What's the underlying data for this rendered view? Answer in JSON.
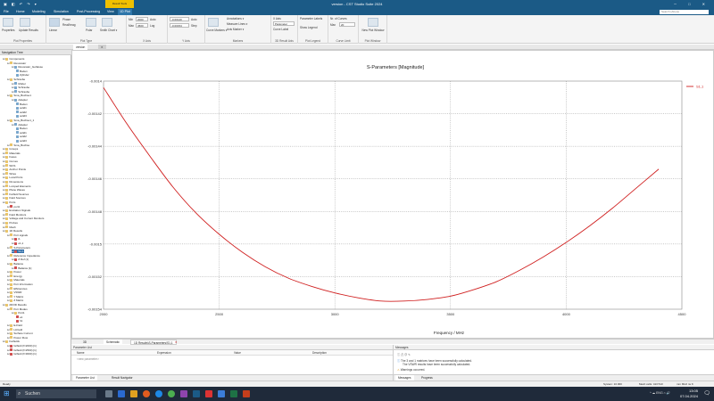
{
  "window": {
    "title": "version - CST Studio Suite 2024",
    "quick_access": "▣ ◧ ↶ ↷ ▾",
    "controls": "─ □ ✕",
    "context_tab": "Result Tools",
    "context_sub": "1D Plot"
  },
  "menu": {
    "items": [
      "File",
      "Home",
      "Modeling",
      "Simulation",
      "Post-Processing",
      "View"
    ],
    "active": "1D Plot",
    "search_placeholder": "Search (Alt+Q)"
  },
  "ribbon": {
    "groups": [
      {
        "label": "Plot Properties"
      },
      {
        "label": "Plot Type"
      },
      {
        "label": "X Axis"
      },
      {
        "label": "Y Axis"
      },
      {
        "label": "Markers"
      },
      {
        "label": "3D Result Axis"
      },
      {
        "label": "Plot Legend"
      },
      {
        "label": "Curve Limit"
      },
      {
        "label": "Plot Window"
      }
    ],
    "properties_btn": "Properties",
    "update_results_btn": "Update Results",
    "linear_btn": "Linear",
    "phase_label": "Phase",
    "real_imag_label": "Real/Imag",
    "polar_label": "Polar",
    "smith_label": "Smith Chart ▾",
    "x_min_label": "Min",
    "x_min_value": "2000",
    "x_max_label": "Max",
    "x_max_value": "4500",
    "x_auto": "Auto",
    "x_log": "Log",
    "y_min_label": "Min",
    "y_min_value": "-0.00154",
    "y_max_label": "Max",
    "y_max_value": "-0.00140",
    "y_auto": "Auto",
    "y_step": "Step",
    "curve_markers": "Curve Markers ▾",
    "annotations": "Annotations ▾",
    "measure_lines": "Measure Lines ▾",
    "axis_marker": "Axis Marker ▾",
    "axis_label": "X Axis",
    "axis_value": "Parameter",
    "curve_label_btn": "Curve Label",
    "param_labels": "Parameter Labels",
    "show_legend": "Show Legend",
    "num_curves_label": "Nr. of Curves",
    "num_curves_max_label": "Max",
    "num_curves_value": "20",
    "new_plot_window": "New Plot Window"
  },
  "doc_tabs": [
    {
      "label": "Navigation Tree"
    },
    {
      "label": "version"
    },
    {
      "label": "3D"
    }
  ],
  "nav": {
    "header": "Navigation Tree",
    "items": [
      {
        "label": "Components",
        "depth": 0,
        "icon": "f"
      },
      {
        "label": "Resonator",
        "depth": 1,
        "icon": "f"
      },
      {
        "label": "Resonator_Gehäuse",
        "depth": 2,
        "icon": "b"
      },
      {
        "label": "Boden",
        "depth": 3,
        "icon": "b"
      },
      {
        "label": "Zylinder",
        "depth": 3,
        "icon": "b"
      },
      {
        "label": "Schraube",
        "depth": 1,
        "icon": "f"
      },
      {
        "label": "Mutter",
        "depth": 2,
        "icon": "b"
      },
      {
        "label": "Schraube",
        "depth": 2,
        "icon": "b"
      },
      {
        "label": "Schraube",
        "depth": 2,
        "icon": "b"
      },
      {
        "label": "Sma_Buchse1",
        "depth": 1,
        "icon": "f"
      },
      {
        "label": "Adapter",
        "depth": 2,
        "icon": "b"
      },
      {
        "label": "Boden",
        "depth": 3,
        "icon": "b"
      },
      {
        "label": "solid1",
        "depth": 3,
        "icon": "b"
      },
      {
        "label": "solid2",
        "depth": 3,
        "icon": "b"
      },
      {
        "label": "solid3",
        "depth": 3,
        "icon": "b"
      },
      {
        "label": "Sma_Buchse1_1",
        "depth": 1,
        "icon": "f"
      },
      {
        "label": "Adapter",
        "depth": 2,
        "icon": "b"
      },
      {
        "label": "Boden",
        "depth": 3,
        "icon": "b"
      },
      {
        "label": "solid1",
        "depth": 3,
        "icon": "b"
      },
      {
        "label": "solid2",
        "depth": 3,
        "icon": "b"
      },
      {
        "label": "solid3",
        "depth": 3,
        "icon": "b"
      },
      {
        "label": "Sma_Buchse",
        "depth": 1,
        "icon": "f"
      },
      {
        "label": "Groups",
        "depth": 0,
        "icon": "f"
      },
      {
        "label": "Materials",
        "depth": 0,
        "icon": "f"
      },
      {
        "label": "Faces",
        "depth": 0,
        "icon": "f"
      },
      {
        "label": "Curves",
        "depth": 0,
        "icon": "f"
      },
      {
        "label": "WCS",
        "depth": 0,
        "icon": "f"
      },
      {
        "label": "Anchor Points",
        "depth": 0,
        "icon": "f"
      },
      {
        "label": "Wires",
        "depth": 0,
        "icon": "f"
      },
      {
        "label": "Local Ports",
        "depth": 0,
        "icon": "f"
      },
      {
        "label": "Dimensions",
        "depth": 0,
        "icon": "f"
      },
      {
        "label": "Lumped Elements",
        "depth": 0,
        "icon": "f"
      },
      {
        "label": "Plane Waves",
        "depth": 0,
        "icon": "f"
      },
      {
        "label": "Farfield Sources",
        "depth": 0,
        "icon": "f"
      },
      {
        "label": "Field Sources",
        "depth": 0,
        "icon": "f"
      },
      {
        "label": "Ports",
        "depth": 0,
        "icon": "f"
      },
      {
        "label": "port1",
        "depth": 1,
        "icon": "r"
      },
      {
        "label": "Excitation Signals",
        "depth": 0,
        "icon": "f"
      },
      {
        "label": "Field Monitors",
        "depth": 0,
        "icon": "f"
      },
      {
        "label": "Voltage and Current Monitors",
        "depth": 0,
        "icon": "f"
      },
      {
        "label": "Probes",
        "depth": 0,
        "icon": "f"
      },
      {
        "label": "Mesh",
        "depth": 0,
        "icon": "f"
      },
      {
        "label": "1D Results",
        "depth": 0,
        "icon": "f"
      },
      {
        "label": "Port signals",
        "depth": 1,
        "icon": "f"
      },
      {
        "label": "i1",
        "depth": 2,
        "icon": "r"
      },
      {
        "label": "o1,1",
        "depth": 2,
        "icon": "r"
      },
      {
        "label": "S-Parameters",
        "depth": 1,
        "icon": "f"
      },
      {
        "label": "S1,1",
        "depth": 2,
        "icon": "r",
        "selected": true
      },
      {
        "label": "Reference Impedance",
        "depth": 1,
        "icon": "f"
      },
      {
        "label": "Z Ref (1)",
        "depth": 2,
        "icon": "r"
      },
      {
        "label": "Balance",
        "depth": 1,
        "icon": "f"
      },
      {
        "label": "Balance [1]",
        "depth": 2,
        "icon": "r"
      },
      {
        "label": "Power",
        "depth": 1,
        "icon": "f"
      },
      {
        "label": "Energy",
        "depth": 1,
        "icon": "f"
      },
      {
        "label": "Materials",
        "depth": 1,
        "icon": "f"
      },
      {
        "label": "Port Information",
        "depth": 1,
        "icon": "f"
      },
      {
        "label": "Efficiencies",
        "depth": 1,
        "icon": "f"
      },
      {
        "label": "VSWR",
        "depth": 1,
        "icon": "f"
      },
      {
        "label": "Y Matrix",
        "depth": 1,
        "icon": "f"
      },
      {
        "label": "Z Matrix",
        "depth": 1,
        "icon": "f"
      },
      {
        "label": "2D/3D Results",
        "depth": 0,
        "icon": "f"
      },
      {
        "label": "Port Modes",
        "depth": 1,
        "icon": "f"
      },
      {
        "label": "Port1",
        "depth": 2,
        "icon": "f"
      },
      {
        "label": "e1",
        "depth": 3,
        "icon": "r"
      },
      {
        "label": "h1",
        "depth": 3,
        "icon": "r"
      },
      {
        "label": "E-Field",
        "depth": 1,
        "icon": "f"
      },
      {
        "label": "H-Field",
        "depth": 1,
        "icon": "f"
      },
      {
        "label": "Surface Current",
        "depth": 1,
        "icon": "f"
      },
      {
        "label": "Power Flow",
        "depth": 1,
        "icon": "f"
      },
      {
        "label": "Farfields",
        "depth": 0,
        "icon": "f"
      },
      {
        "label": "farfield (f=2000) [1]",
        "depth": 1,
        "icon": "r"
      },
      {
        "label": "farfield (f=2500) [1]",
        "depth": 1,
        "icon": "r"
      },
      {
        "label": "farfield (f=3000) [1]",
        "depth": 1,
        "icon": "r"
      }
    ]
  },
  "chart_data": {
    "type": "line",
    "title": "S-Parameters [Magnitude]",
    "xlabel": "Frequency / MHz",
    "ylabel": "",
    "xlim": [
      2000,
      4500
    ],
    "ylim": [
      -0.00154,
      -0.0014
    ],
    "x_ticks": [
      "2000",
      "2500",
      "3000",
      "3500",
      "4000",
      "4500"
    ],
    "y_ticks": [
      "-0.0014",
      "-0.00142",
      "-0.00144",
      "-0.00146",
      "-0.00148",
      "-0.0015",
      "-0.00152",
      "-0.00154"
    ],
    "grid": true,
    "legend_position": "top-right",
    "series": [
      {
        "name": "S1,1",
        "color": "#d02020",
        "x": [
          2000,
          2100,
          2200,
          2300,
          2400,
          2500,
          2600,
          2700,
          2800,
          2900,
          3000,
          3100,
          3200,
          3300,
          3400,
          3500,
          3600,
          3700,
          3800,
          3900,
          4000,
          4100,
          4200,
          4300,
          4400
        ],
        "values": [
          -0.001404,
          -0.001426,
          -0.001446,
          -0.001465,
          -0.001481,
          -0.001494,
          -0.001505,
          -0.001514,
          -0.001521,
          -0.001526,
          -0.00153,
          -0.001533,
          -0.001535,
          -0.001535,
          -0.001534,
          -0.001532,
          -0.001528,
          -0.001523,
          -0.001516,
          -0.001508,
          -0.001499,
          -0.001489,
          -0.001478,
          -0.001466,
          -0.001454
        ]
      }
    ]
  },
  "plot_tabs": [
    {
      "label": "3D"
    },
    {
      "label": "Schematic"
    },
    {
      "label": "1D Results\\S-Parameters\\S1,1"
    }
  ],
  "param_list": {
    "title": "Parameter List",
    "cols": [
      "Name",
      "Expression",
      "Value",
      "Description"
    ],
    "filter": "<new parameter>",
    "tabs": [
      "Parameter List",
      "Result Navigator"
    ]
  },
  "messages": {
    "title": "Messages",
    "lines": [
      "The 3 and 1 matrices have been successfully calculated.",
      "The VSWR results have been successfully calculated.",
      "Warnings occurred."
    ],
    "tabs": [
      "Messages",
      "Progress"
    ]
  },
  "status": {
    "left": "Ready",
    "items": [
      "System: 10.000",
      "Mesh cells: 413 513",
      "mm  MHz  ns  K"
    ]
  },
  "taskbar": {
    "search_label": "Suchen",
    "time": "13:05",
    "date": "07.04.2024",
    "tray": "^  ☁  ENG  ⌂  🔊"
  }
}
